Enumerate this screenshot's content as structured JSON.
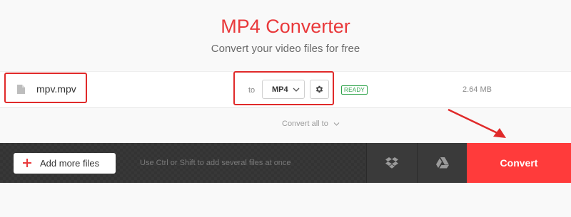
{
  "header": {
    "title": "MP4 Converter",
    "subtitle": "Convert your video files for free"
  },
  "file": {
    "name": "mpv.mpv",
    "to_label": "to",
    "format": "MP4",
    "status": "READY",
    "size": "2.64 MB"
  },
  "convert_all": {
    "label": "Convert all to"
  },
  "toolbar": {
    "add_label": "Add more files",
    "hint": "Use Ctrl or Shift to add several files at once",
    "convert_label": "Convert"
  },
  "icons": {
    "file": "file-icon",
    "settings": "gear-icon",
    "dropdown": "chevron-down-icon",
    "add": "plus-icon",
    "dropbox": "dropbox-icon",
    "drive": "google-drive-icon"
  },
  "colors": {
    "accent": "#e9393b",
    "convert_button": "#ff3b3b",
    "status_ready": "#2ea34a",
    "annotation": "#e02a2a",
    "bottom_bar": "#333333"
  }
}
